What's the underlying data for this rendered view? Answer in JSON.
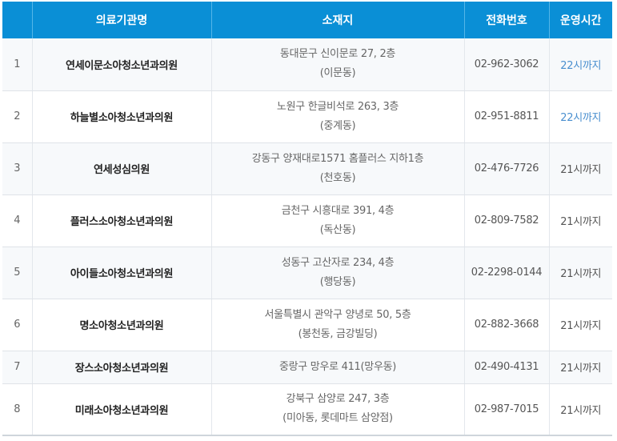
{
  "table": {
    "headers": {
      "no": "",
      "name": "의료기관명",
      "address": "소재지",
      "phone": "전화번호",
      "hours": "운영시간"
    },
    "rows": [
      {
        "no": "1",
        "name": "연세이문소아청소년과의원",
        "address1": "동대문구 신이문로 27, 2층",
        "address2": "(이문동)",
        "phone": "02-962-3062",
        "hours": "22시까지"
      },
      {
        "no": "2",
        "name": "하늘별소아청소년과의원",
        "address1": "노원구 한글비석로 263, 3층",
        "address2": "(중계동)",
        "phone": "02-951-8811",
        "hours": "22시까지"
      },
      {
        "no": "3",
        "name": "연세성심의원",
        "address1": "강동구 양재대로1571 홈플러스 지하1층",
        "address2": "(천호동)",
        "phone": "02-476-7726",
        "hours": "21시까지"
      },
      {
        "no": "4",
        "name": "플러스소아청소년과의원",
        "address1": "금천구 시흥대로 391, 4층",
        "address2": "(독산동)",
        "phone": "02-809-7582",
        "hours": "21시까지"
      },
      {
        "no": "5",
        "name": "아이들소아청소년과의원",
        "address1": "성동구 고산자로 234, 4층",
        "address2": "(행당동)",
        "phone": "02-2298-0144",
        "hours": "21시까지"
      },
      {
        "no": "6",
        "name": "명소아청소년과의원",
        "address1": "서울특별시 관악구 양녕로 50, 5층",
        "address2": "(봉천동, 금강빌딩)",
        "phone": "02-882-3668",
        "hours": "21시까지"
      },
      {
        "no": "7",
        "name": "장스소아청소년과의원",
        "address1": "중랑구 망우로 411(망우동)",
        "address2": "",
        "phone": "02-490-4131",
        "hours": "21시까지"
      },
      {
        "no": "8",
        "name": "미래소아청소년과의원",
        "address1": "강북구 삼양로 247, 3층",
        "address2": "(미아동, 롯데마트 삼양점)",
        "phone": "02-987-7015",
        "hours": "21시까지"
      }
    ]
  },
  "colors": {
    "header_bg": "#0a8fd6",
    "highlight_hours": "#4a8fcf"
  }
}
